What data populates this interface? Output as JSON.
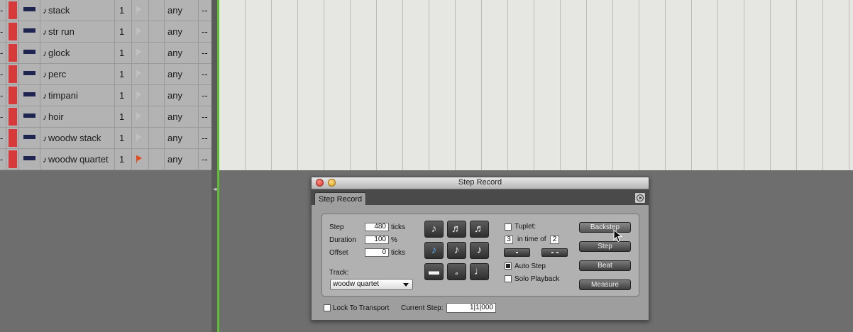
{
  "tracks": [
    {
      "dash": "-",
      "name": "stack",
      "num": "1",
      "flag_active": false,
      "output": "any",
      "extra": "--"
    },
    {
      "dash": "-",
      "name": "str run",
      "num": "1",
      "flag_active": false,
      "output": "any",
      "extra": "--"
    },
    {
      "dash": "-",
      "name": "glock",
      "num": "1",
      "flag_active": false,
      "output": "any",
      "extra": "--"
    },
    {
      "dash": "-",
      "name": "perc",
      "num": "1",
      "flag_active": false,
      "output": "any",
      "extra": "--"
    },
    {
      "dash": "-",
      "name": "timpani",
      "num": "1",
      "flag_active": false,
      "output": "any",
      "extra": "--"
    },
    {
      "dash": "-",
      "name": "hoir",
      "num": "1",
      "flag_active": false,
      "output": "any",
      "extra": "--"
    },
    {
      "dash": "-",
      "name": "woodw stack",
      "num": "1",
      "flag_active": false,
      "output": "any",
      "extra": "--"
    },
    {
      "dash": "-",
      "name": "woodw quartet",
      "num": "1",
      "flag_active": true,
      "output": "any",
      "extra": "--"
    }
  ],
  "note_glyph": "♪",
  "step_record": {
    "window_title": "Step Record",
    "tab_label": "Step Record",
    "step_label": "Step",
    "step_value": "480",
    "step_unit": "ticks",
    "duration_label": "Duration",
    "duration_value": "100",
    "duration_unit": "%",
    "offset_label": "Offset",
    "offset_value": "0",
    "offset_unit": "ticks",
    "track_label": "Track:",
    "track_value": "woodw quartet",
    "note_buttons": [
      "♪",
      "♬",
      "♬",
      "♪",
      "♪",
      "♪",
      "▬",
      "𝅗",
      "♩"
    ],
    "selected_note_index": 3,
    "tuplet_label": "Tuplet:",
    "tuplet_checked": false,
    "tuplet_num": "3",
    "in_time_of_label": "in time of",
    "tuplet_den": "2",
    "auto_step_label": "Auto Step",
    "auto_step_checked": true,
    "solo_playback_label": "Solo Playback",
    "solo_playback_checked": false,
    "backstep_label": "Backstep",
    "step_button_label": "Step",
    "beat_label": "Beat",
    "measure_label": "Measure",
    "lock_to_transport_label": "Lock To Transport",
    "lock_to_transport_checked": false,
    "current_step_label": "Current Step:",
    "current_step_value": "1|1|000"
  }
}
